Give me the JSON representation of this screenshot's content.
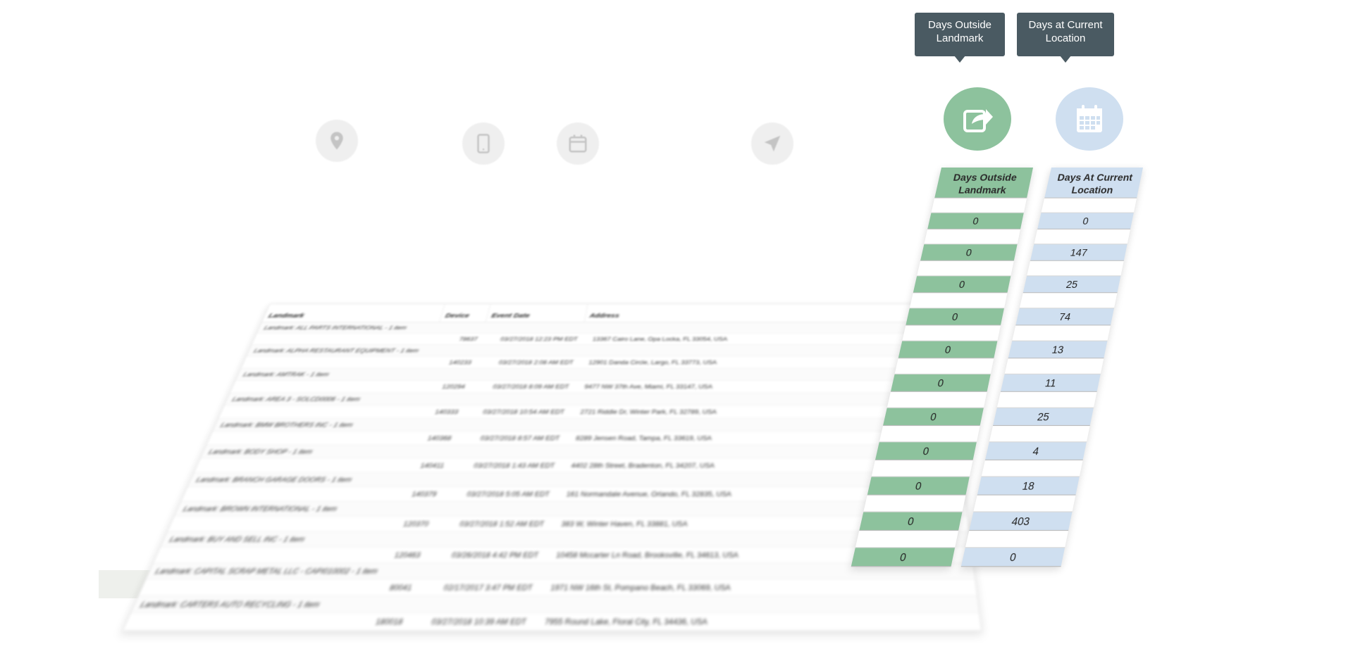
{
  "icons": {
    "landmark": "map-pin-icon",
    "device": "tablet-icon",
    "event_date": "calendar-icon",
    "address": "navigation-arrow-icon",
    "days_outside": "share-arrow-icon",
    "days_current": "calendar-grid-icon"
  },
  "colors": {
    "green": "#8dc29d",
    "blue": "#cfdff0",
    "tooltip": "#4a5a62"
  },
  "tooltips": {
    "days_outside": "Days Outside Landmark",
    "days_current": "Days at Current Location"
  },
  "table": {
    "headers": [
      "Landmark",
      "Device",
      "Event Date",
      "Address"
    ],
    "groups": [
      {
        "label": "Landmark: ALL PARTS INTERNATIONAL - 1 item",
        "device": "78637",
        "date": "03/27/2018 12:23 PM EDT",
        "address": "13367 Cairo Lane, Opa Locka, FL 33054, USA"
      },
      {
        "label": "Landmark: ALPHA RESTAURANT EQUIPMENT - 1 item",
        "device": "140233",
        "date": "03/27/2018 2:08 AM EDT",
        "address": "12901 Danda Circle, Largo, FL 33773, USA"
      },
      {
        "label": "Landmark: AMTRAK - 1 item",
        "device": "120294",
        "date": "03/27/2018 8:09 AM EDT",
        "address": "9477 NW 37th Ave, Miami, FL 33147, USA"
      },
      {
        "label": "Landmark: AREA 3 - SOLCD0006 - 1 item",
        "device": "140333",
        "date": "03/27/2018 10:54 AM EDT",
        "address": "2721 Riddle Dr, Winter Park, FL 32789, USA"
      },
      {
        "label": "Landmark: BMW BROTHERS INC - 1 item",
        "device": "140368",
        "date": "03/27/2018 8:57 AM EDT",
        "address": "8289 Jensen Road, Tampa, FL 33619, USA"
      },
      {
        "label": "Landmark: BODY SHOP - 1 item",
        "device": "140411",
        "date": "03/27/2018 1:43 AM EDT",
        "address": "4402 28th Street, Bradenton, FL 34207, USA"
      },
      {
        "label": "Landmark: BRANCH GARAGE DOORS - 1 item",
        "device": "140379",
        "date": "03/27/2018 5:05 AM EDT",
        "address": "161 Normandale Avenue, Orlando, FL 32835, USA"
      },
      {
        "label": "Landmark: BROWN INTERNATIONAL - 1 item",
        "device": "120370",
        "date": "03/27/2018 1:52 AM EDT",
        "address": "383 W, Winter Haven, FL 33881, USA"
      },
      {
        "label": "Landmark: BUY AND SELL INC - 1 item",
        "device": "120463",
        "date": "03/26/2018 4:42 PM EDT",
        "address": "10458 Mccarter Ln Road, Brooksville, FL 34613, USA"
      },
      {
        "label": "Landmark: CAPITAL SCRAP METAL LLC - CAPI010002 - 1 item",
        "device": "80041",
        "date": "02/17/2017 3:47 PM EDT",
        "address": "1971 NW 16th St, Pompano Beach, FL 33069, USA"
      },
      {
        "label": "Landmark: CARTERS AUTO RECYCLING - 1 item",
        "device": "180018",
        "date": "03/27/2018 10:39 AM EDT",
        "address": "7955 Round Lake, Floral City, FL 34436, USA"
      }
    ]
  },
  "days_outside": {
    "header": "Days Outside Landmark",
    "values": [
      "0",
      "0",
      "0",
      "0",
      "0",
      "0",
      "0",
      "0",
      "0",
      "0",
      "0"
    ]
  },
  "days_current": {
    "header": "Days At Current Location",
    "values": [
      "0",
      "147",
      "25",
      "74",
      "13",
      "11",
      "25",
      "4",
      "18",
      "403",
      "0"
    ]
  }
}
